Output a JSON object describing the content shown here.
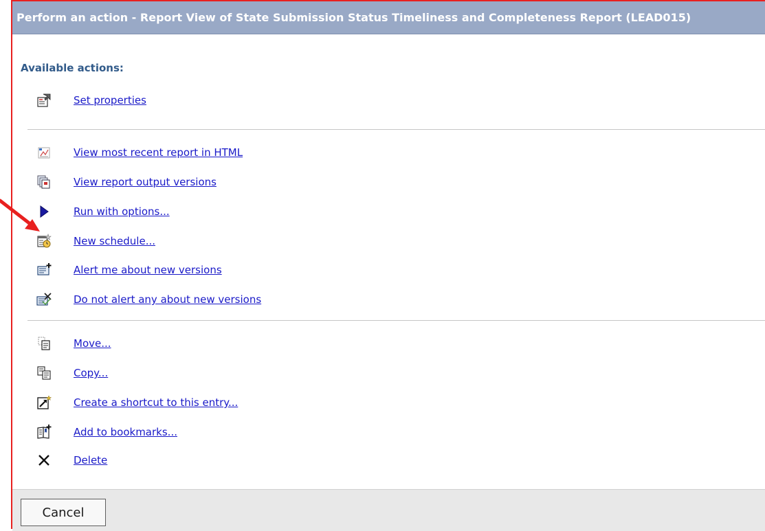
{
  "title": "Perform an action - Report View of State Submission Status Timeliness and Completeness Report (LEAD015)",
  "heading": "Available actions:",
  "actions": [
    {
      "label": "Set properties",
      "icon": "properties-icon"
    },
    {
      "label": "View most recent report in HTML",
      "icon": "html-report-icon"
    },
    {
      "label": "View report output versions",
      "icon": "output-versions-icon"
    },
    {
      "label": "Run with options...",
      "icon": "run-icon"
    },
    {
      "label": "New schedule...",
      "icon": "schedule-icon"
    },
    {
      "label": "Alert me about new versions",
      "icon": "alert-icon"
    },
    {
      "label": "Do not alert any about new versions",
      "icon": "no-alert-icon"
    },
    {
      "label": "Move...",
      "icon": "move-icon"
    },
    {
      "label": "Copy...",
      "icon": "copy-icon"
    },
    {
      "label": "Create a shortcut to this entry...",
      "icon": "shortcut-icon"
    },
    {
      "label": "Add to bookmarks...",
      "icon": "bookmark-icon"
    },
    {
      "label": "Delete",
      "icon": "delete-icon"
    }
  ],
  "cancel_label": "Cancel",
  "colors": {
    "titlebar": "#99a9c6",
    "heading": "#325b8a",
    "link": "#1a1ac8",
    "annotation_red": "#e8201f"
  }
}
